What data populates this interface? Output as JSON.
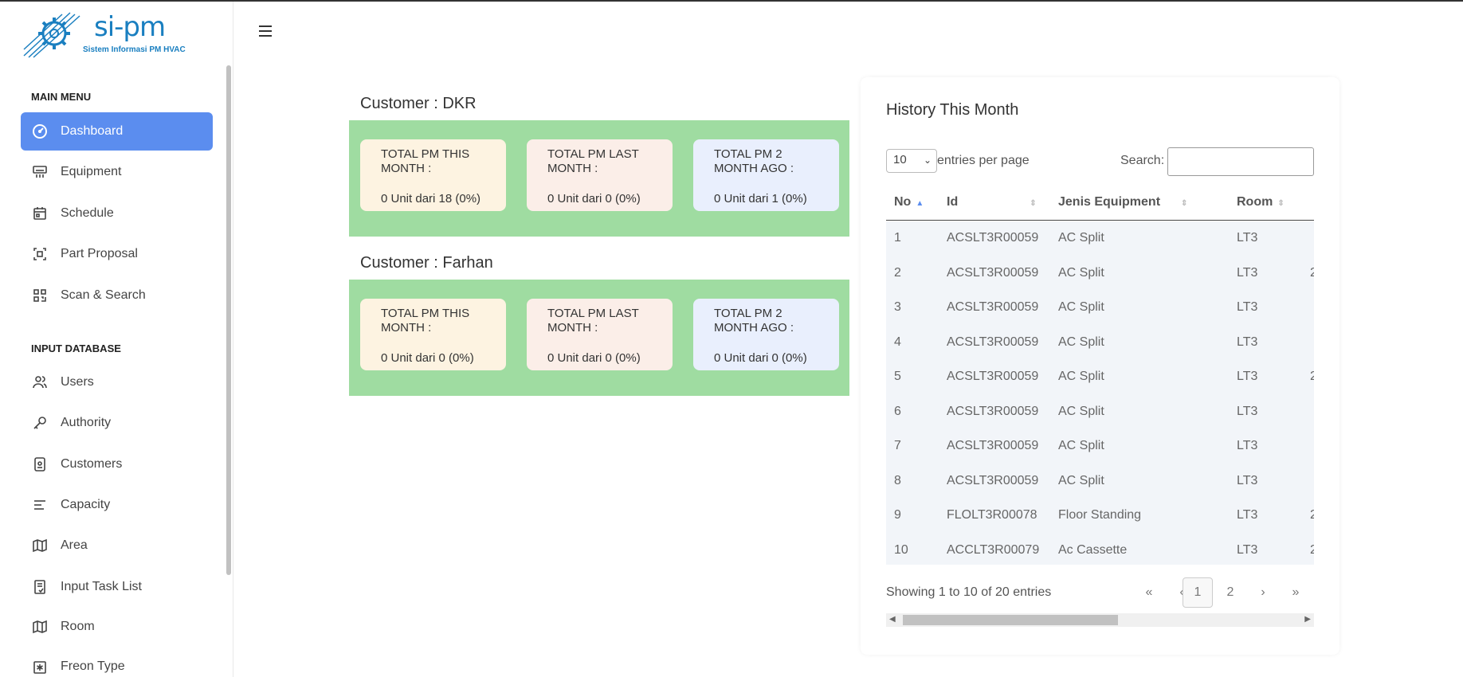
{
  "app": {
    "logo_text": "si-pm",
    "logo_sub": "Sistem Informasi PM HVAC"
  },
  "sidebar": {
    "main_menu_label": "MAIN MENU",
    "input_db_label": "INPUT DATABASE",
    "main_items": [
      {
        "label": "Dashboard",
        "icon": "dashboard-icon"
      },
      {
        "label": "Equipment",
        "icon": "air-conditioner-icon"
      },
      {
        "label": "Schedule",
        "icon": "calendar-icon"
      },
      {
        "label": "Part Proposal",
        "icon": "focus-icon"
      },
      {
        "label": "Scan & Search",
        "icon": "qr-code-icon"
      }
    ],
    "db_items": [
      {
        "label": "Users",
        "icon": "users-icon"
      },
      {
        "label": "Authority",
        "icon": "key-icon"
      },
      {
        "label": "Customers",
        "icon": "id-badge-icon"
      },
      {
        "label": "Capacity",
        "icon": "align-left-icon"
      },
      {
        "label": "Area",
        "icon": "map-icon"
      },
      {
        "label": "Input Task List",
        "icon": "task-list-icon"
      },
      {
        "label": "Room",
        "icon": "map-icon"
      },
      {
        "label": "Freon Type",
        "icon": "asterisk-box-icon"
      }
    ]
  },
  "customers": [
    {
      "title": "Customer : DKR",
      "cards": [
        {
          "label": "TOTAL PM THIS MONTH :",
          "value": "0 Unit dari 18 (0%)"
        },
        {
          "label": "TOTAL PM LAST MONTH :",
          "value": "0 Unit dari 0 (0%)"
        },
        {
          "label": "TOTAL PM 2 MONTH AGO :",
          "value": "0 Unit dari 1 (0%)"
        }
      ]
    },
    {
      "title": "Customer : Farhan",
      "cards": [
        {
          "label": "TOTAL PM THIS MONTH :",
          "value": "0 Unit dari 0 (0%)"
        },
        {
          "label": "TOTAL PM LAST MONTH :",
          "value": "0 Unit dari 0 (0%)"
        },
        {
          "label": "TOTAL PM 2 MONTH AGO :",
          "value": "0 Unit dari 0 (0%)"
        }
      ]
    }
  ],
  "history": {
    "title": "History This Month",
    "entries_value": "10",
    "entries_label": "entries per page",
    "search_label": "Search:",
    "columns": [
      "No",
      "Id",
      "Jenis Equipment",
      "Room"
    ],
    "rows": [
      {
        "no": "1",
        "id": "ACSLT3R00059",
        "jenis": "AC Split",
        "room": "LT3",
        "extra": ""
      },
      {
        "no": "2",
        "id": "ACSLT3R00059",
        "jenis": "AC Split",
        "room": "LT3",
        "extra": "2"
      },
      {
        "no": "3",
        "id": "ACSLT3R00059",
        "jenis": "AC Split",
        "room": "LT3",
        "extra": ""
      },
      {
        "no": "4",
        "id": "ACSLT3R00059",
        "jenis": "AC Split",
        "room": "LT3",
        "extra": ""
      },
      {
        "no": "5",
        "id": "ACSLT3R00059",
        "jenis": "AC Split",
        "room": "LT3",
        "extra": "2"
      },
      {
        "no": "6",
        "id": "ACSLT3R00059",
        "jenis": "AC Split",
        "room": "LT3",
        "extra": ""
      },
      {
        "no": "7",
        "id": "ACSLT3R00059",
        "jenis": "AC Split",
        "room": "LT3",
        "extra": ""
      },
      {
        "no": "8",
        "id": "ACSLT3R00059",
        "jenis": "AC Split",
        "room": "LT3",
        "extra": ""
      },
      {
        "no": "9",
        "id": "FLOLT3R00078",
        "jenis": "Floor Standing",
        "room": "LT3",
        "extra": "2"
      },
      {
        "no": "10",
        "id": "ACCLT3R00079",
        "jenis": "Ac Cassette",
        "room": "LT3",
        "extra": "2"
      }
    ],
    "showing": "Showing 1 to 10 of 20 entries",
    "pagination": {
      "first": "«",
      "prev": "‹",
      "page1": "1",
      "page2": "2",
      "next": "›",
      "last": "»"
    }
  },
  "colors": {
    "accent": "#5b8def",
    "band": "#9fdca1",
    "brand": "#1a7fc0"
  }
}
